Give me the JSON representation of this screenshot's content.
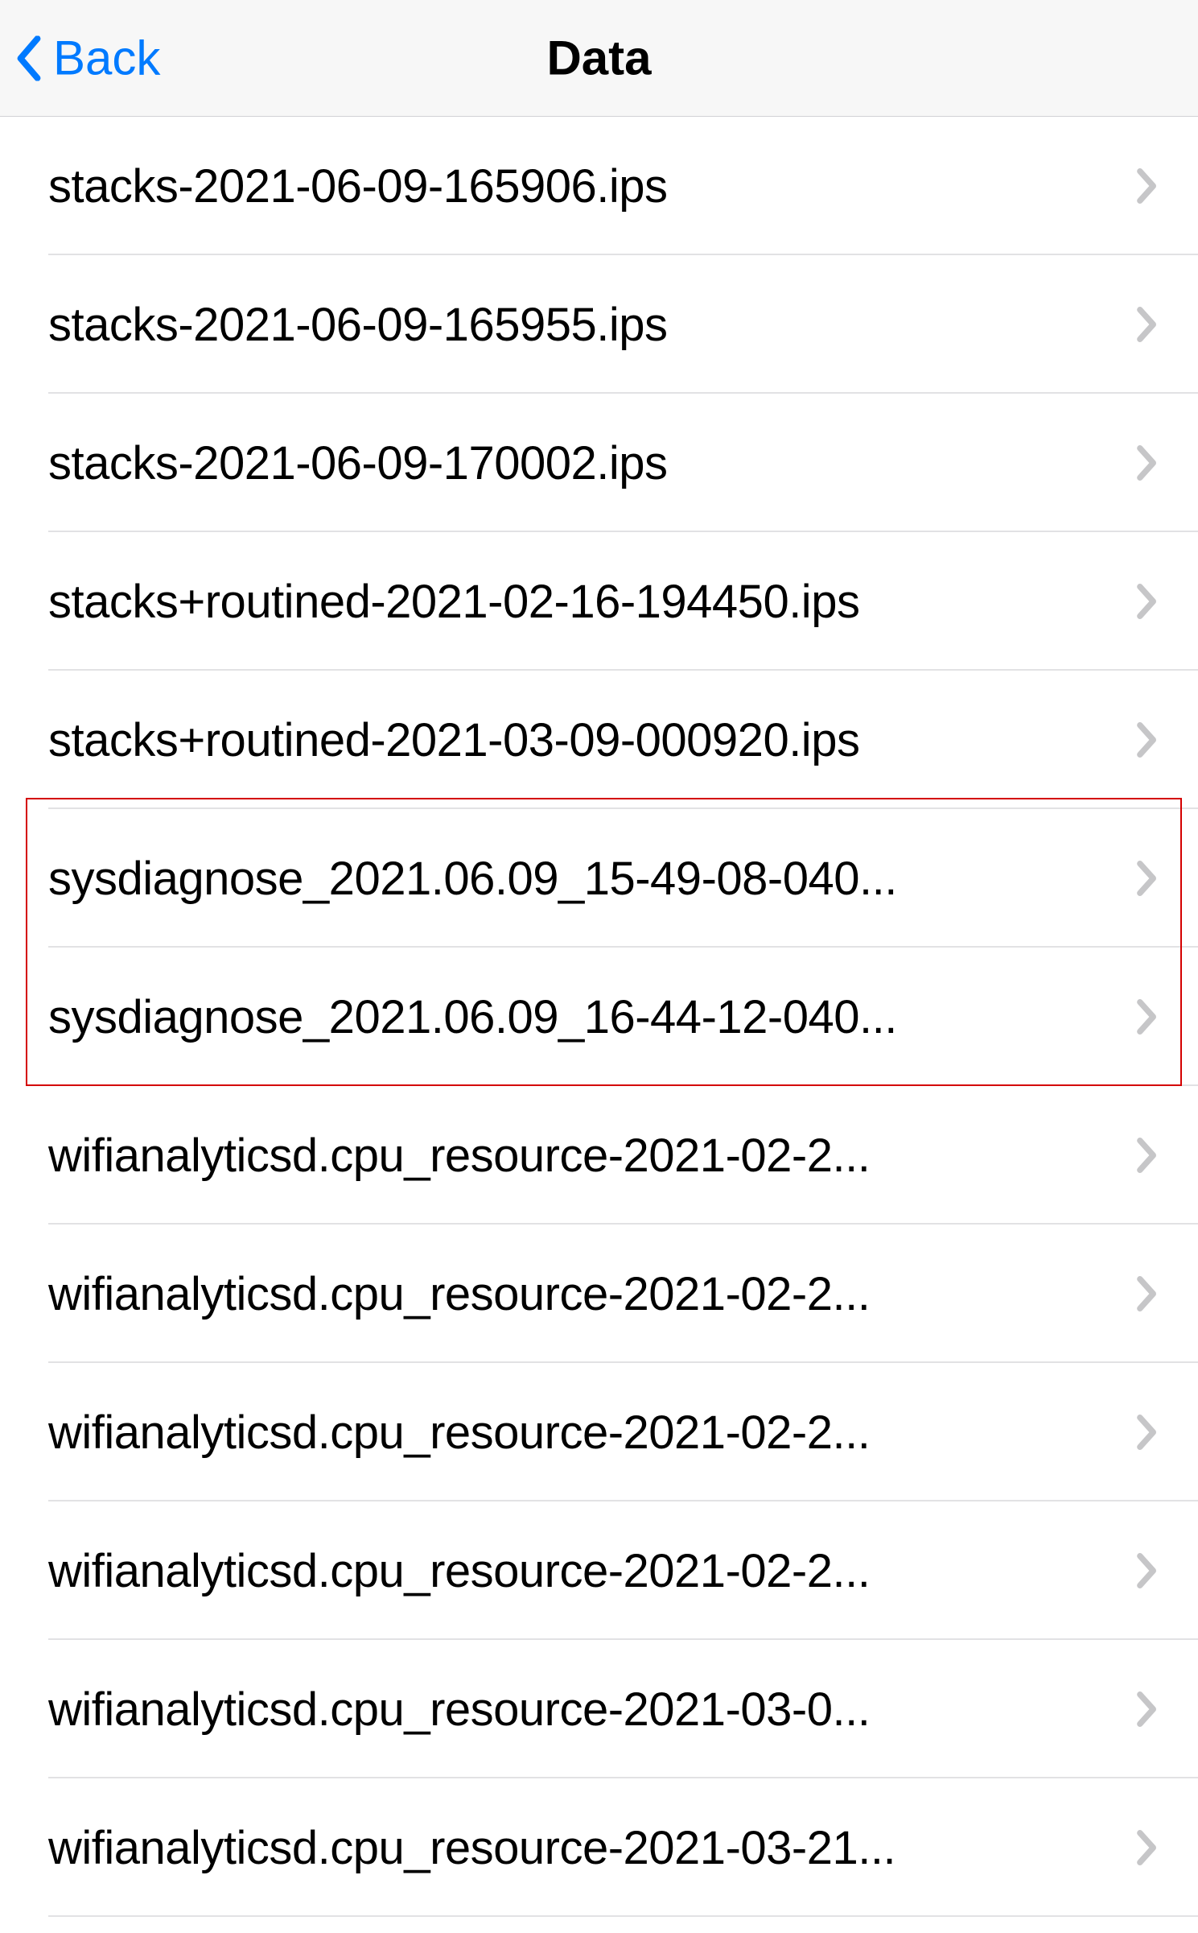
{
  "nav": {
    "back_label": "Back",
    "title": "Data"
  },
  "files": [
    {
      "name": "stacks-2021-06-09-165906.ips"
    },
    {
      "name": "stacks-2021-06-09-165955.ips"
    },
    {
      "name": "stacks-2021-06-09-170002.ips"
    },
    {
      "name": "stacks+routined-2021-02-16-194450.ips"
    },
    {
      "name": "stacks+routined-2021-03-09-000920.ips"
    },
    {
      "name": "sysdiagnose_2021.06.09_15-49-08-040..."
    },
    {
      "name": "sysdiagnose_2021.06.09_16-44-12-040..."
    },
    {
      "name": "wifianalyticsd.cpu_resource-2021-02-2..."
    },
    {
      "name": "wifianalyticsd.cpu_resource-2021-02-2..."
    },
    {
      "name": "wifianalyticsd.cpu_resource-2021-02-2..."
    },
    {
      "name": "wifianalyticsd.cpu_resource-2021-02-2..."
    },
    {
      "name": "wifianalyticsd.cpu_resource-2021-03-0..."
    },
    {
      "name": "wifianalyticsd.cpu_resource-2021-03-21..."
    }
  ],
  "annotation": {
    "highlight_start_index": 5,
    "highlight_end_index": 6
  }
}
